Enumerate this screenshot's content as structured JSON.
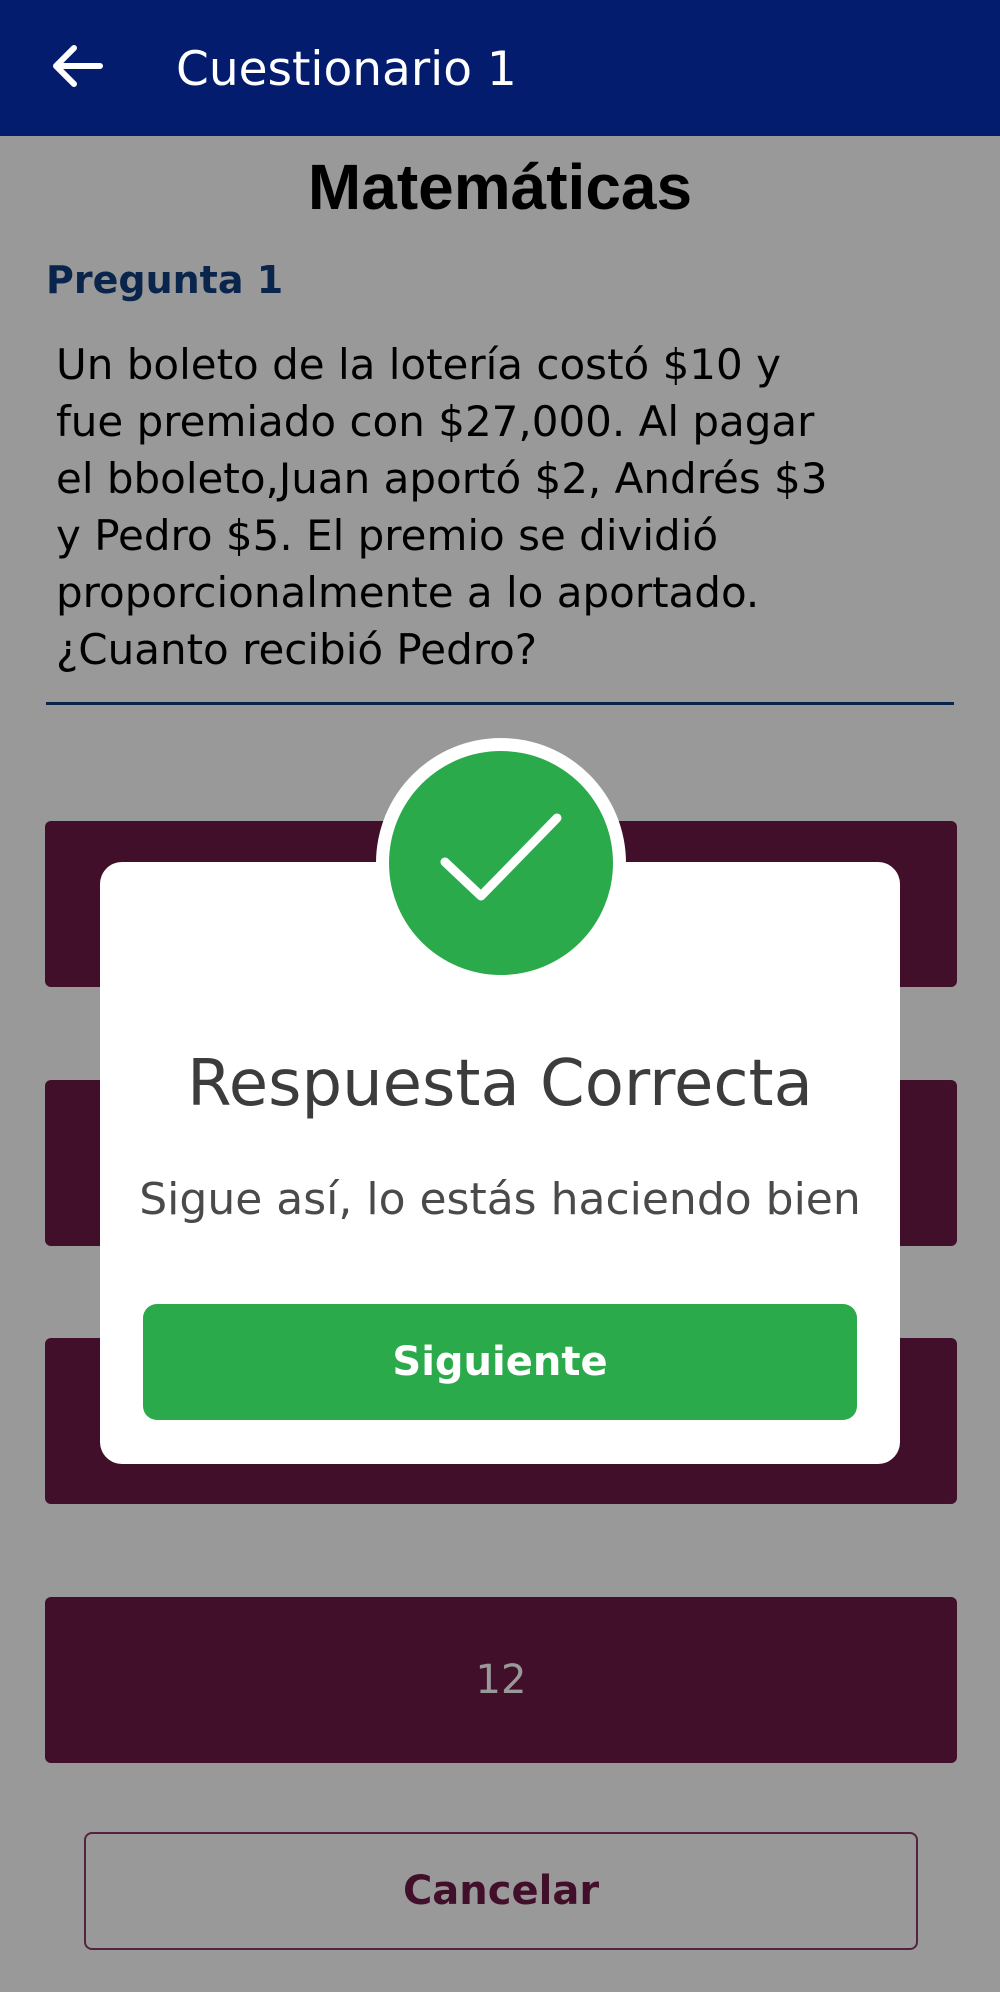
{
  "appbar": {
    "title": "Cuestionario 1",
    "back_icon": "arrow-left-icon",
    "background": "#031c6e"
  },
  "quiz": {
    "subject": "Matemáticas",
    "question_label": "Pregunta 1",
    "question_text": "Un boleto de la lotería costó $10 y fue premiado con $27,000. Al pagar el bboleto,Juan aportó $2, Andrés $3 y Pedro $5. El premio se dividió proporcionalmente a lo aportado. ¿Cuanto recibió Pedro?",
    "options": [
      "",
      "",
      "",
      "12"
    ],
    "cancel_label": "Cancelar"
  },
  "dialog": {
    "icon": "check-icon",
    "title": "Respuesta Correcta",
    "message": "Sigue así, lo estás haciendo bien",
    "next_label": "Siguiente"
  },
  "colors": {
    "accent_green": "#2aaa4a",
    "option_bg": "#6e1a48",
    "link_blue": "#0f3f7f"
  }
}
